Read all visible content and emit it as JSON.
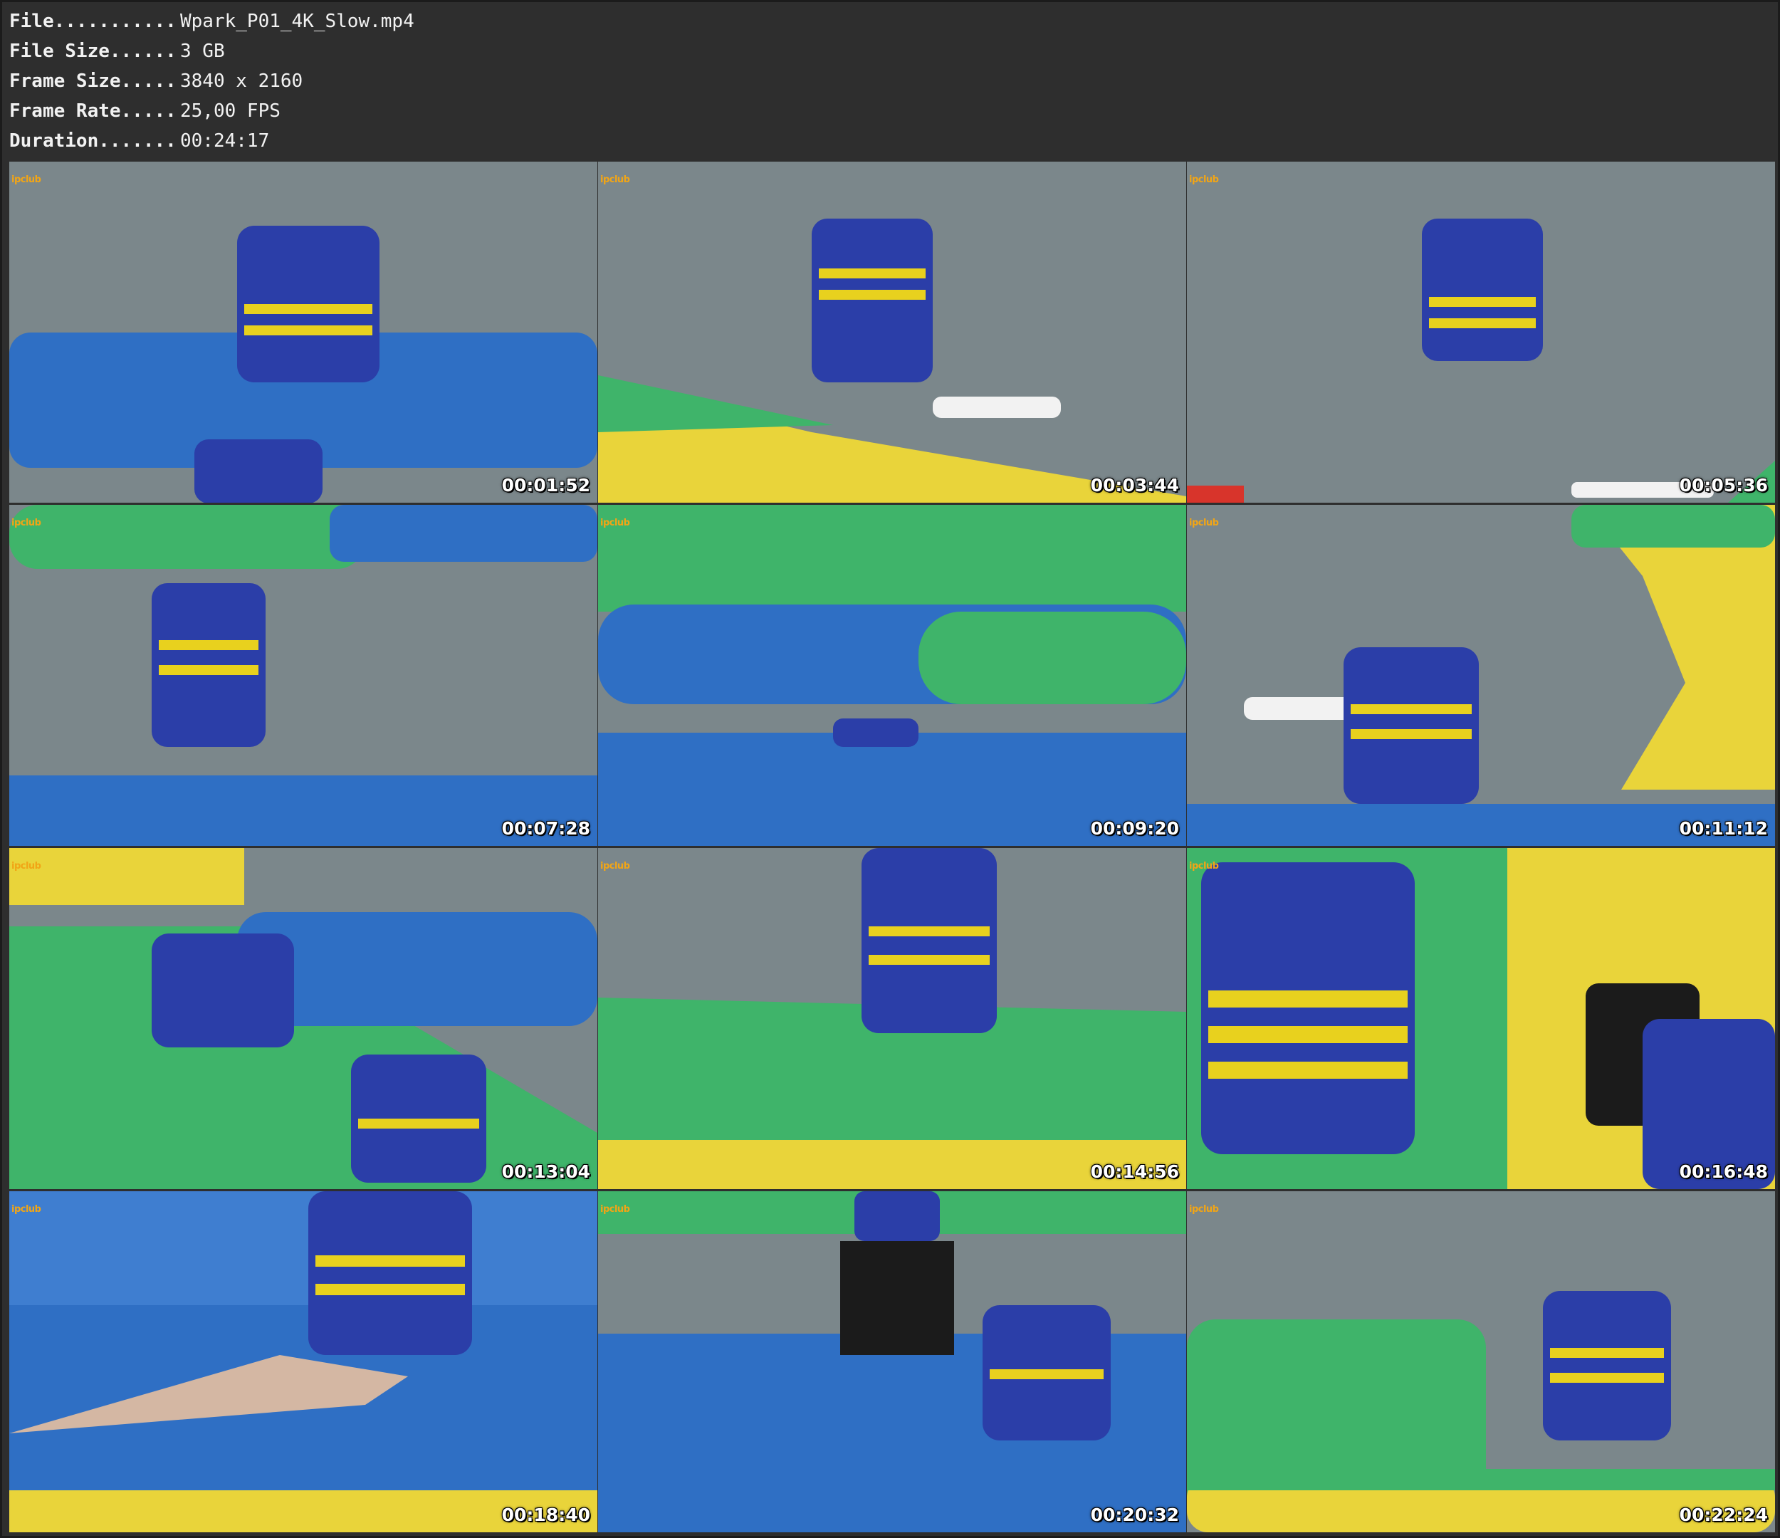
{
  "info": {
    "rows": [
      {
        "key": "File...........",
        "value": "Wpark_P01_4K_Slow.mp4"
      },
      {
        "key": "File Size......",
        "value": "3 GB"
      },
      {
        "key": "Frame Size.....",
        "value": "3840 x 2160"
      },
      {
        "key": "Frame Rate.....",
        "value": "25,00 FPS"
      },
      {
        "key": "Duration.......",
        "value": "00:24:17"
      }
    ]
  },
  "thumbnails": [
    {
      "timestamp": "00:01:52",
      "logo": "ipclub"
    },
    {
      "timestamp": "00:03:44",
      "logo": "ipclub"
    },
    {
      "timestamp": "00:05:36",
      "logo": "ipclub"
    },
    {
      "timestamp": "00:07:28",
      "logo": "ipclub"
    },
    {
      "timestamp": "00:09:20",
      "logo": "ipclub"
    },
    {
      "timestamp": "00:11:12",
      "logo": "ipclub"
    },
    {
      "timestamp": "00:13:04",
      "logo": "ipclub"
    },
    {
      "timestamp": "00:14:56",
      "logo": "ipclub"
    },
    {
      "timestamp": "00:16:48",
      "logo": "ipclub"
    },
    {
      "timestamp": "00:18:40",
      "logo": "ipclub"
    },
    {
      "timestamp": "00:20:32",
      "logo": "ipclub"
    },
    {
      "timestamp": "00:22:24",
      "logo": "ipclub"
    }
  ],
  "colors": {
    "water": "#7b878b",
    "inflatable_blue": "#2f6fc4",
    "inflatable_green": "#3fb46a",
    "inflatable_yellow": "#e9d43a",
    "vest_blue": "#2b3ea8",
    "vest_yellow": "#e8d11e",
    "timestamp": "#ffffff"
  }
}
